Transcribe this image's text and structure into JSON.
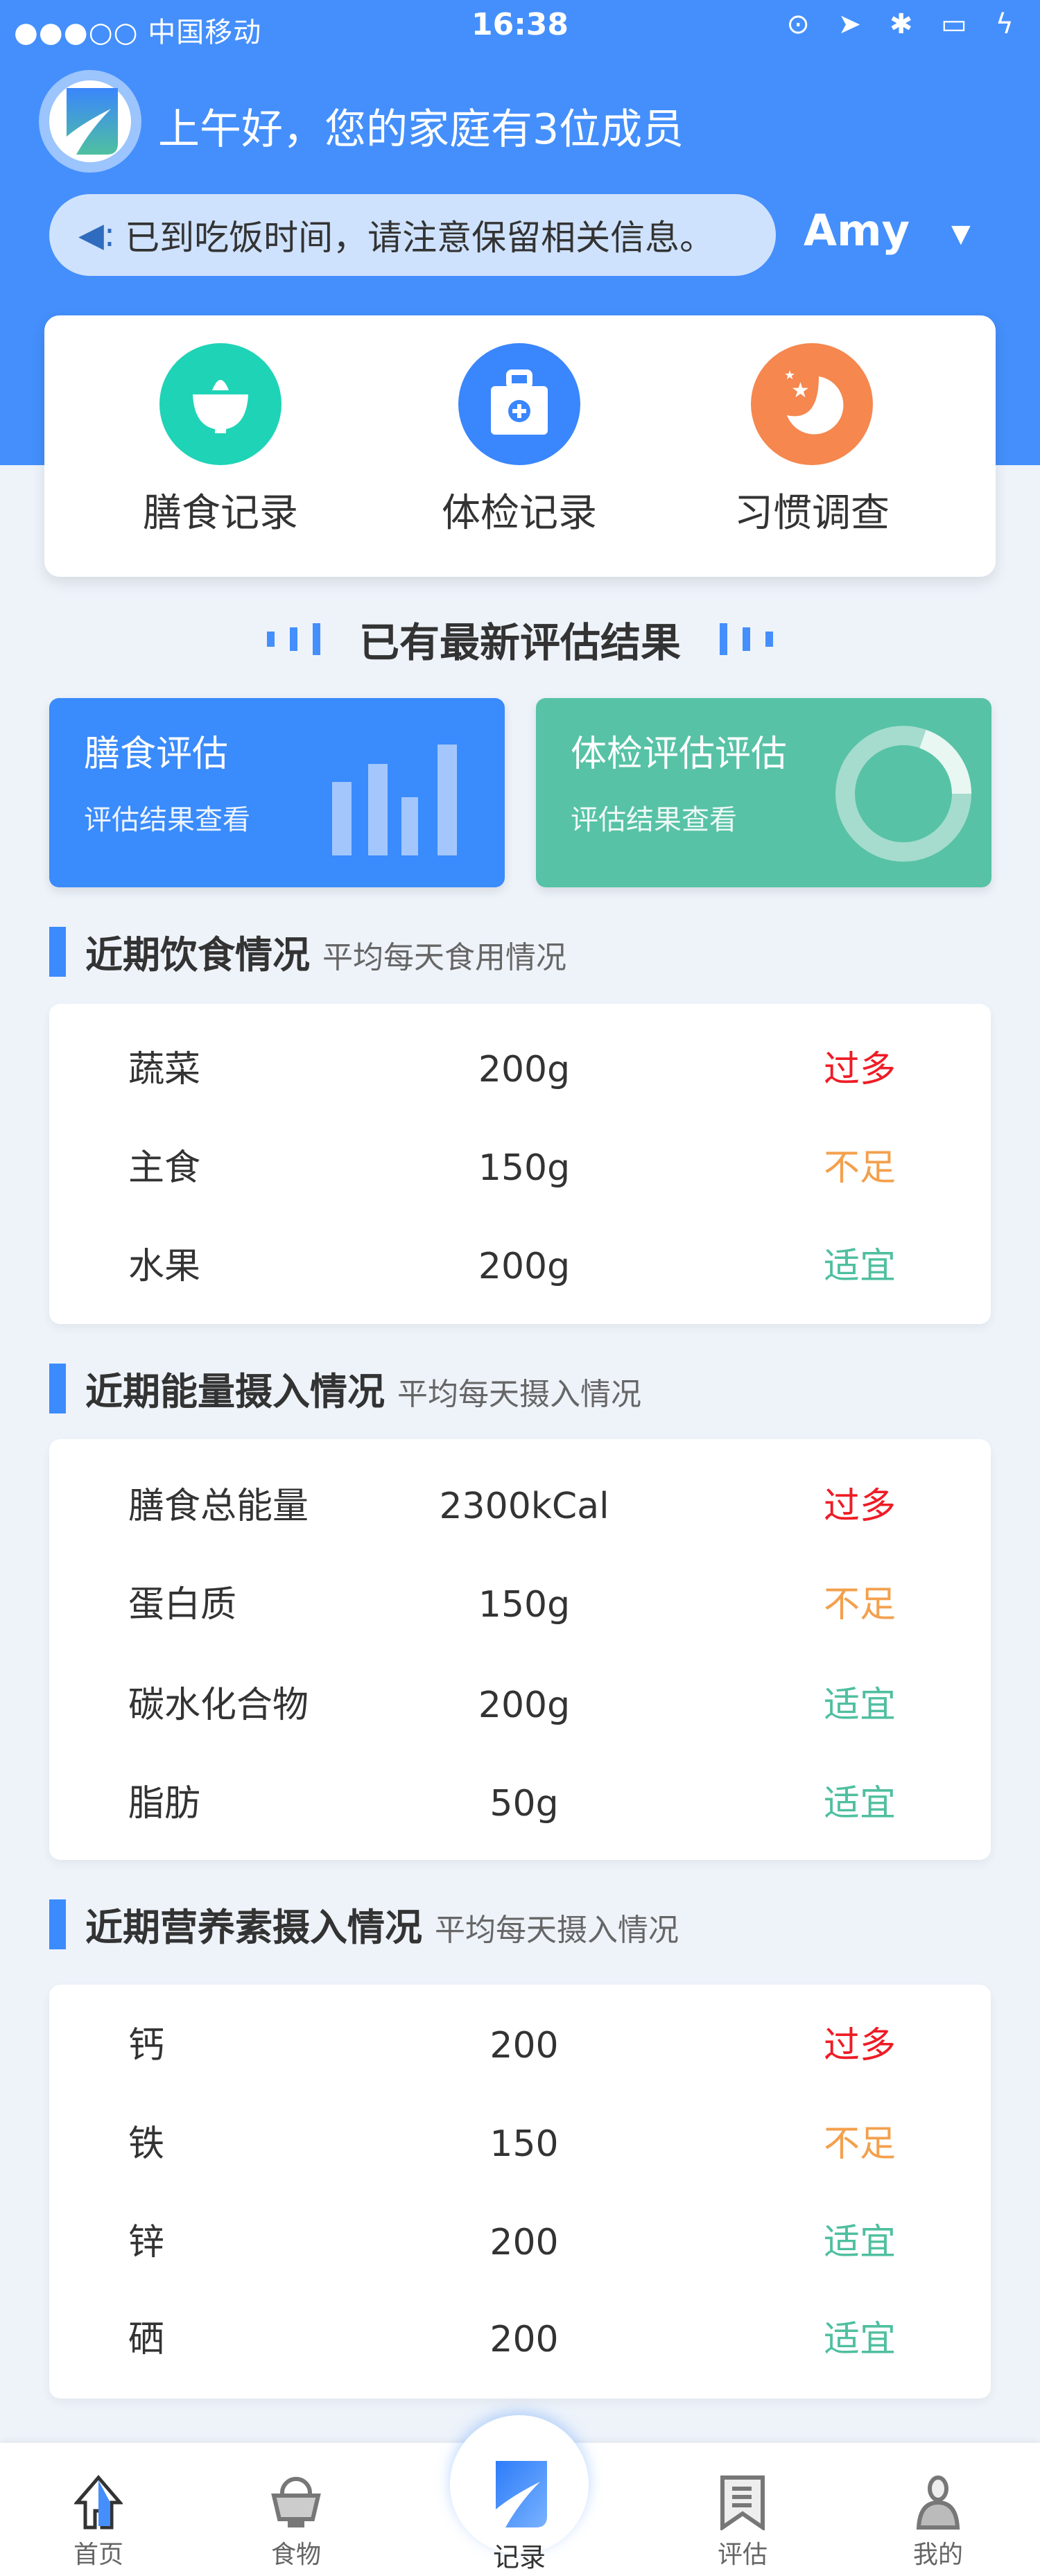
{
  "status_bar": {
    "carrier": "●●●○○ 中国移动",
    "time": "16:38"
  },
  "header": {
    "greeting": "上午好，您的家庭有3位成员",
    "notice": "已到吃饭时间，请注意保留相关信息。",
    "user": "Amy"
  },
  "quick_actions": [
    {
      "label": "膳食记录",
      "icon": "rice-bowl-icon",
      "color": "#1fd3b6"
    },
    {
      "label": "体检记录",
      "icon": "medical-kit-icon",
      "color": "#3a86fc"
    },
    {
      "label": "习惯调查",
      "icon": "moon-star-icon",
      "color": "#f5874f"
    }
  ],
  "eval_heading": "已有最新评估结果",
  "eval_cards": [
    {
      "title": "膳食评估",
      "subtitle": "评估结果查看",
      "color": "#3a8bfc"
    },
    {
      "title": "体检评估评估",
      "subtitle": "评估结果查看",
      "color": "#57c2a6"
    }
  ],
  "status_colors": {
    "过多": "#ee1c25",
    "不足": "#f3a04d",
    "适宜": "#4fbf9f"
  },
  "sections": [
    {
      "title": "近期饮食情况",
      "subtitle": "平均每天食用情况",
      "rows": [
        {
          "name": "蔬菜",
          "value": "200g",
          "status": "过多"
        },
        {
          "name": "主食",
          "value": "150g",
          "status": "不足"
        },
        {
          "name": "水果",
          "value": "200g",
          "status": "适宜"
        }
      ]
    },
    {
      "title": "近期能量摄入情况",
      "subtitle": "平均每天摄入情况",
      "rows": [
        {
          "name": "膳食总能量",
          "value": "2300kCal",
          "status": "过多"
        },
        {
          "name": "蛋白质",
          "value": "150g",
          "status": "不足"
        },
        {
          "name": "碳水化合物",
          "value": "200g",
          "status": "适宜"
        },
        {
          "name": "脂肪",
          "value": "50g",
          "status": "适宜"
        }
      ]
    },
    {
      "title": "近期营养素摄入情况",
      "subtitle": "平均每天摄入情况",
      "rows": [
        {
          "name": "钙",
          "value": "200",
          "status": "过多"
        },
        {
          "name": "铁",
          "value": "150",
          "status": "不足"
        },
        {
          "name": "锌",
          "value": "200",
          "status": "适宜"
        },
        {
          "name": "硒",
          "value": "200",
          "status": "适宜"
        }
      ]
    }
  ],
  "tabs": [
    {
      "label": "首页",
      "icon": "home-icon"
    },
    {
      "label": "食物",
      "icon": "food-icon"
    },
    {
      "label": "记录",
      "icon": "record-icon",
      "active": true
    },
    {
      "label": "评估",
      "icon": "evaluation-icon"
    },
    {
      "label": "我的",
      "icon": "profile-icon"
    }
  ]
}
